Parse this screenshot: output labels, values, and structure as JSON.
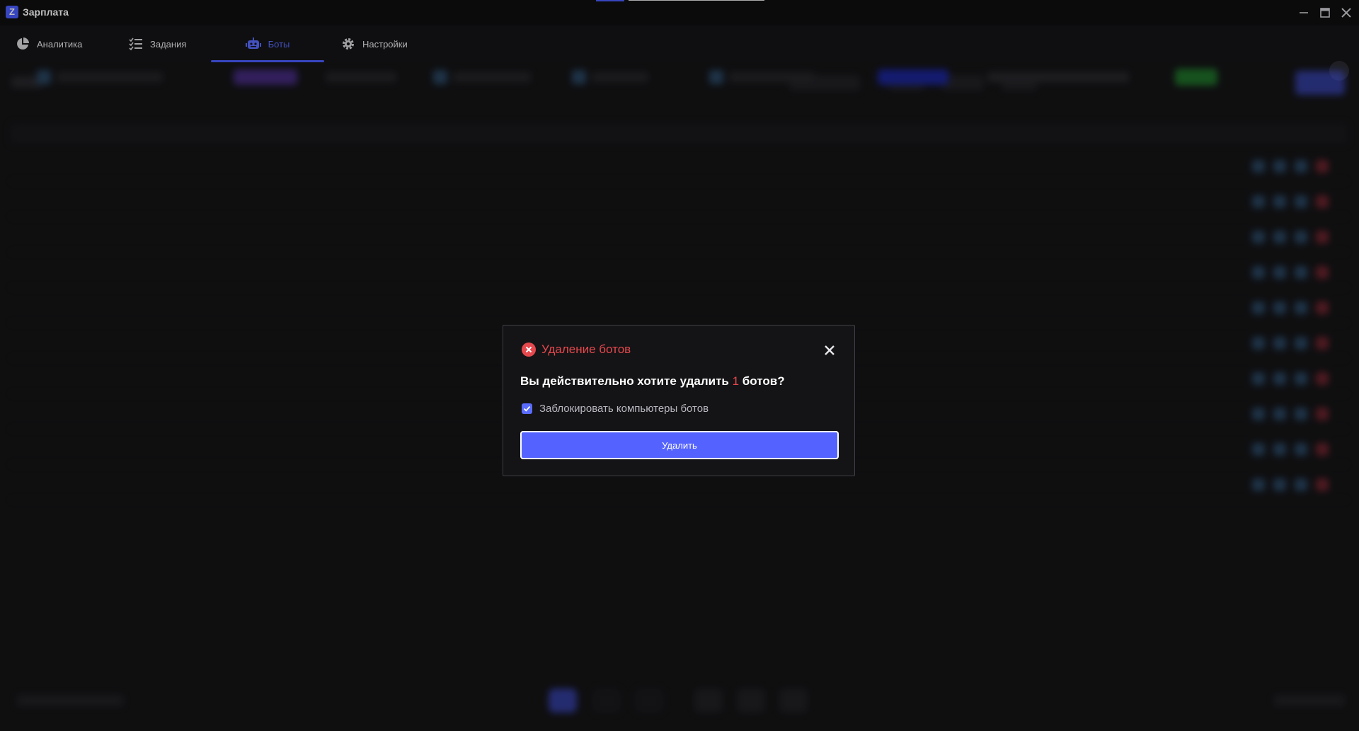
{
  "app": {
    "title": "Зарплата",
    "logo_letter": "Z"
  },
  "window_controls": [
    "minimize-icon",
    "maximize-icon",
    "close-icon"
  ],
  "tabs": [
    {
      "label": "Аналитика",
      "icon": "pie-chart-icon",
      "active": false
    },
    {
      "label": "Задания",
      "icon": "checklist-icon",
      "active": false
    },
    {
      "label": "Боты",
      "icon": "robot-icon",
      "active": true
    },
    {
      "label": "Настройки",
      "icon": "gear-icon",
      "active": false
    }
  ],
  "dialog": {
    "title": "Удаление ботов",
    "question_prefix": "Вы действительно хотите удалить ",
    "count": "1",
    "question_suffix": " ботов?",
    "checkbox_label": "Заблокировать компьютеры ботов",
    "checkbox_checked": true,
    "confirm_label": "Удалить"
  },
  "colors": {
    "accent": "#4a5cff",
    "danger": "#e5484d",
    "background": "#141416"
  }
}
